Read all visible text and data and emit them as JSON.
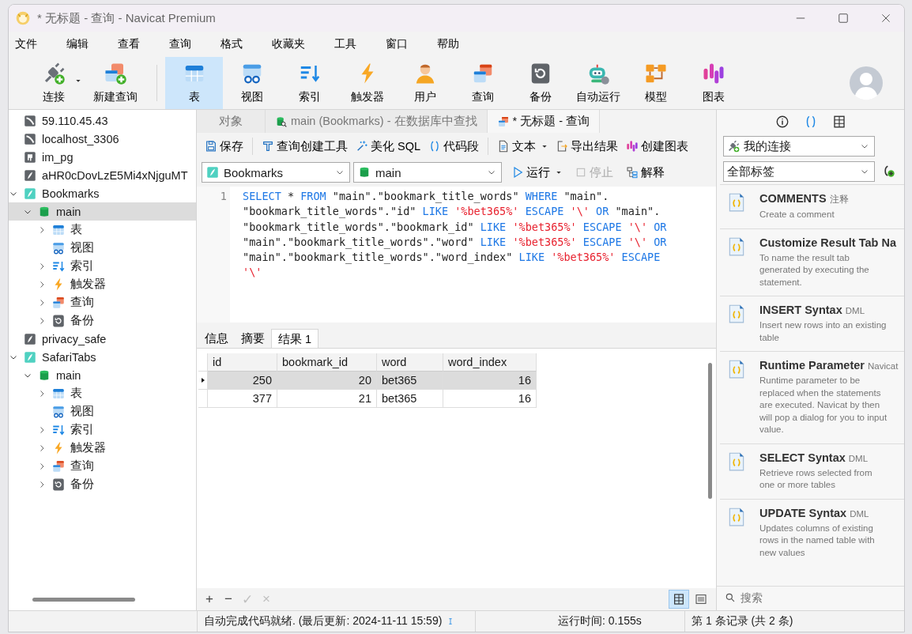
{
  "window": {
    "title": "* 无标题 - 查询 - Navicat Premium"
  },
  "menu": [
    "文件",
    "编辑",
    "查看",
    "查询",
    "格式",
    "收藏夹",
    "工具",
    "窗口",
    "帮助"
  ],
  "toolbar": [
    {
      "label": "连接",
      "kind": "connect",
      "selected": false,
      "dropdown": true
    },
    {
      "label": "新建查询",
      "kind": "new-query",
      "selected": false,
      "dropdown": false
    },
    {
      "label": "表",
      "kind": "table",
      "selected": true,
      "dropdown": false
    },
    {
      "label": "视图",
      "kind": "view",
      "selected": false,
      "dropdown": false
    },
    {
      "label": "索引",
      "kind": "index",
      "selected": false,
      "dropdown": false
    },
    {
      "label": "触发器",
      "kind": "trigger",
      "selected": false,
      "dropdown": false
    },
    {
      "label": "用户",
      "kind": "user",
      "selected": false,
      "dropdown": false
    },
    {
      "label": "查询",
      "kind": "query",
      "selected": false,
      "dropdown": false
    },
    {
      "label": "备份",
      "kind": "backup",
      "selected": false,
      "dropdown": false
    },
    {
      "label": "自动运行",
      "kind": "automation",
      "selected": false,
      "dropdown": false
    },
    {
      "label": "模型",
      "kind": "model",
      "selected": false,
      "dropdown": false
    },
    {
      "label": "图表",
      "kind": "chart",
      "selected": false,
      "dropdown": false
    }
  ],
  "tree": [
    {
      "label": "59.110.45.43",
      "kind": "mysql",
      "selected": false
    },
    {
      "label": "localhost_3306",
      "kind": "mysql",
      "selected": false
    },
    {
      "label": "im_pg",
      "kind": "postgres",
      "selected": false
    },
    {
      "label": "aHR0cDovLzE5Mi4xNjguMT",
      "kind": "sqlite",
      "selected": false
    },
    {
      "label": "Bookmarks",
      "kind": "sqlite-open",
      "selected": false,
      "expanded": true,
      "children": [
        {
          "label": "main",
          "kind": "database",
          "selected": true,
          "expanded": true,
          "children": [
            {
              "label": "表",
              "kind": "table",
              "selected": false,
              "expanded": false
            },
            {
              "label": "视图",
              "kind": "view",
              "selected": false
            },
            {
              "label": "索引",
              "kind": "index",
              "selected": false,
              "expanded": false
            },
            {
              "label": "触发器",
              "kind": "trigger",
              "selected": false,
              "expanded": false
            },
            {
              "label": "查询",
              "kind": "query",
              "selected": false,
              "expanded": false
            },
            {
              "label": "备份",
              "kind": "backup",
              "selected": false,
              "expanded": false
            }
          ]
        }
      ]
    },
    {
      "label": "privacy_safe",
      "kind": "sqlite",
      "selected": false
    },
    {
      "label": "SafariTabs",
      "kind": "sqlite-open",
      "selected": false,
      "expanded": true,
      "children": [
        {
          "label": "main",
          "kind": "database",
          "selected": false,
          "expanded": true,
          "children": [
            {
              "label": "表",
              "kind": "table",
              "selected": false,
              "expanded": false
            },
            {
              "label": "视图",
              "kind": "view",
              "selected": false
            },
            {
              "label": "索引",
              "kind": "index",
              "selected": false,
              "expanded": false
            },
            {
              "label": "触发器",
              "kind": "trigger",
              "selected": false,
              "expanded": false
            },
            {
              "label": "查询",
              "kind": "query",
              "selected": false,
              "expanded": false
            },
            {
              "label": "备份",
              "kind": "backup",
              "selected": false,
              "expanded": false
            }
          ]
        }
      ]
    }
  ],
  "tabs": [
    {
      "label": "对象",
      "kind": "plain",
      "selected": false
    },
    {
      "label": "main (Bookmarks) - 在数据库中查找",
      "kind": "find",
      "selected": false
    },
    {
      "label": "* 无标题 - 查询",
      "kind": "query",
      "selected": true
    }
  ],
  "editor_toolbar": [
    {
      "label": "保存",
      "kind": "save",
      "dropdown": false
    },
    {
      "label": "查询创建工具",
      "kind": "builder",
      "dropdown": false
    },
    {
      "label": "美化 SQL",
      "kind": "beautify",
      "dropdown": false
    },
    {
      "label": "代码段",
      "kind": "snippet",
      "dropdown": false
    },
    {
      "label": "文本",
      "kind": "text",
      "dropdown": true
    },
    {
      "label": "导出结果",
      "kind": "export",
      "dropdown": false
    },
    {
      "label": "创建图表",
      "kind": "chart",
      "dropdown": false
    }
  ],
  "connection_select": {
    "value": "Bookmarks"
  },
  "database_select": {
    "value": "main"
  },
  "run_buttons": [
    {
      "label": "运行",
      "kind": "run",
      "disabled": false,
      "dropdown": true
    },
    {
      "label": "停止",
      "kind": "stop",
      "disabled": true,
      "dropdown": false
    },
    {
      "label": "解释",
      "kind": "explain",
      "disabled": false,
      "dropdown": false
    }
  ],
  "editor": {
    "line_number": "1",
    "lines": [
      [
        {
          "text": "SELECT",
          "kind": "keyword"
        },
        {
          "text": " * ",
          "kind": "plain"
        },
        {
          "text": "FROM",
          "kind": "keyword"
        },
        {
          "text": " \"main\".\"bookmark_title_words\" ",
          "kind": "plain"
        },
        {
          "text": "WHERE",
          "kind": "keyword"
        },
        {
          "text": " \"main\".",
          "kind": "plain"
        }
      ],
      [
        {
          "text": "\"bookmark_title_words\".\"id\" ",
          "kind": "plain"
        },
        {
          "text": "LIKE ",
          "kind": "keyword"
        },
        {
          "text": "'%bet365%' ",
          "kind": "string"
        },
        {
          "text": "ESCAPE ",
          "kind": "keyword"
        },
        {
          "text": "'\\' ",
          "kind": "string"
        },
        {
          "text": "OR",
          "kind": "keyword"
        },
        {
          "text": " \"main\".",
          "kind": "plain"
        }
      ],
      [
        {
          "text": "\"bookmark_title_words\".\"bookmark_id\" ",
          "kind": "plain"
        },
        {
          "text": "LIKE ",
          "kind": "keyword"
        },
        {
          "text": "'%bet365%' ",
          "kind": "string"
        },
        {
          "text": "ESCAPE ",
          "kind": "keyword"
        },
        {
          "text": "'\\' ",
          "kind": "string"
        },
        {
          "text": "OR",
          "kind": "keyword"
        }
      ],
      [
        {
          "text": "\"main\".\"bookmark_title_words\".\"word\" ",
          "kind": "plain"
        },
        {
          "text": "LIKE ",
          "kind": "keyword"
        },
        {
          "text": "'%bet365%' ",
          "kind": "string"
        },
        {
          "text": "ESCAPE ",
          "kind": "keyword"
        },
        {
          "text": "'\\' ",
          "kind": "string"
        },
        {
          "text": "OR",
          "kind": "keyword"
        }
      ],
      [
        {
          "text": "\"main\".\"bookmark_title_words\".\"word_index\" ",
          "kind": "plain"
        },
        {
          "text": "LIKE ",
          "kind": "keyword"
        },
        {
          "text": "'%bet365%' ",
          "kind": "string"
        },
        {
          "text": "ESCAPE",
          "kind": "keyword"
        }
      ],
      [
        {
          "text": "'\\'",
          "kind": "string"
        }
      ]
    ]
  },
  "result_tabs": [
    {
      "label": "信息",
      "selected": false
    },
    {
      "label": "摘要",
      "selected": false
    },
    {
      "label": "结果 1",
      "selected": true
    }
  ],
  "table": {
    "columns": [
      {
        "label": "id",
        "numeric": true
      },
      {
        "label": "bookmark_id",
        "numeric": true
      },
      {
        "label": "word",
        "numeric": false
      },
      {
        "label": "word_index",
        "numeric": true
      }
    ],
    "rows": [
      {
        "cells": [
          "250",
          "20",
          "bet365",
          "16"
        ],
        "selected": true
      },
      {
        "cells": [
          "377",
          "21",
          "bet365",
          "16"
        ],
        "selected": false
      }
    ]
  },
  "grid_actions": [
    {
      "label": "+",
      "disabled": false
    },
    {
      "label": "−",
      "disabled": false
    },
    {
      "label": "✓",
      "disabled": true
    },
    {
      "label": "×",
      "disabled": true
    }
  ],
  "view_modes": [
    {
      "kind": "grid",
      "selected": true
    },
    {
      "kind": "form",
      "selected": false
    }
  ],
  "side_panel": {
    "tabs": [
      {
        "kind": "info",
        "selected": false
      },
      {
        "kind": "snippet",
        "selected": true
      },
      {
        "kind": "grid",
        "selected": false
      }
    ],
    "connection_filter": {
      "value": "我的连接"
    },
    "tag_filter": {
      "value": "全部标签"
    },
    "snippets": [
      {
        "title": "COMMENTS",
        "tag": "注释",
        "description": "Create a comment"
      },
      {
        "title": "Customize Result Tab Na",
        "description": "To name the result tab generated by executing the statement."
      },
      {
        "title": "INSERT Syntax",
        "tag": "DML",
        "description": "Insert new rows into an existing table"
      },
      {
        "title": "Runtime Parameter",
        "tag": "Navicat",
        "description": "Runtime parameter to be replaced when the statements are executed. Navicat by then will pop a dialog for you to input value."
      },
      {
        "title": "SELECT Syntax",
        "tag": "DML",
        "description": "Retrieve rows selected from one or more tables"
      },
      {
        "title": "UPDATE Syntax",
        "tag": "DML",
        "description": "Updates columns of existing rows in the named table with new values"
      }
    ],
    "search": {
      "placeholder": "搜索"
    }
  },
  "status_bar": {
    "message": "自动完成代码就绪. (最后更新: 2024-11-11 15:59)",
    "run_time": "运行时间: 0.155s",
    "record": "第 1 条记录 (共 2 条)"
  }
}
